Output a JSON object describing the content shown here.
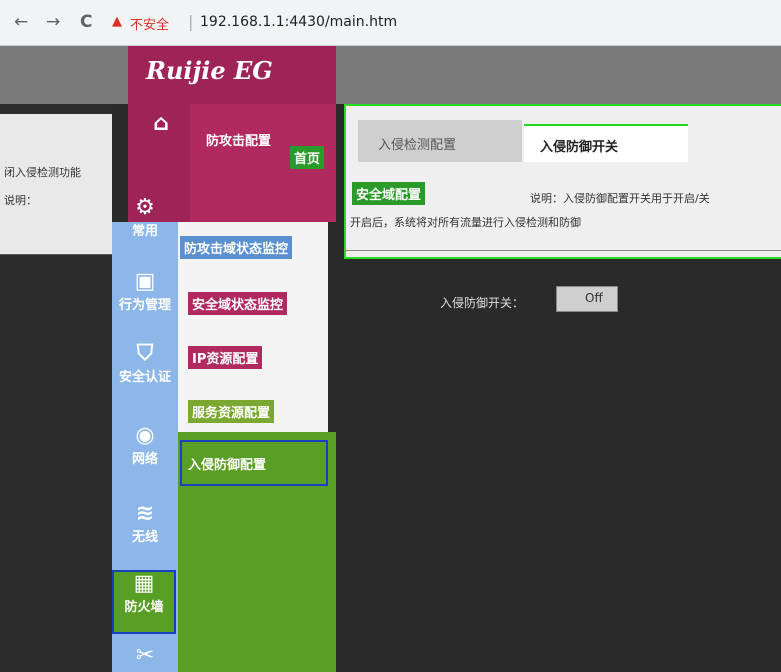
{
  "browser": {
    "back": "←",
    "forward": "→",
    "reload": "C",
    "warning_icon": "▲",
    "security_text": "不安全",
    "url": "192.168.1.1:4430/main.htm"
  },
  "brand": {
    "logo": "Ruijie EG"
  },
  "sidebar": {
    "items": [
      {
        "icon": "home-icon",
        "glyph": "⌂",
        "label": "首页"
      },
      {
        "icon": "gear-icon",
        "glyph": "⚙",
        "label": "常用"
      },
      {
        "icon": "monitor-icon",
        "glyph": "▣",
        "label": "行为管理"
      },
      {
        "icon": "shield-icon",
        "glyph": "⛉",
        "label": "安全认证"
      },
      {
        "icon": "globe-icon",
        "glyph": "◉",
        "label": "网络"
      },
      {
        "icon": "wifi-icon",
        "glyph": "≋",
        "label": "无线"
      },
      {
        "icon": "firewall-icon",
        "glyph": "▦",
        "label": "防火墙"
      },
      {
        "icon": "tools-icon",
        "glyph": "✂",
        "label": ""
      }
    ]
  },
  "submenu": {
    "items": [
      {
        "label": "防攻击配置"
      },
      {
        "label": "防攻击域状态监控"
      },
      {
        "label": "安全域配置"
      },
      {
        "label": "安全域状态监控"
      },
      {
        "label": "IP资源配置"
      },
      {
        "label": "服务资源配置"
      },
      {
        "label": "入侵防御配置"
      }
    ]
  },
  "left_panel": {
    "line1": "闭入侵检测功能",
    "line2": "说明："
  },
  "content": {
    "tabs": [
      {
        "label": "入侵检测配置"
      },
      {
        "label": "入侵防御开关"
      }
    ],
    "note": "说明：入侵防御配置开关用于开启/关",
    "note2": "开启后，系统将对所有流量进行入侵检测和防御",
    "switch_label": "入侵防御开关：",
    "switch_value": "Off"
  },
  "colors": {
    "brand": "#9e2357",
    "sidebar_blue": "#8db7e8",
    "active_green": "#5a9f25",
    "highlight": "#22dd22"
  }
}
